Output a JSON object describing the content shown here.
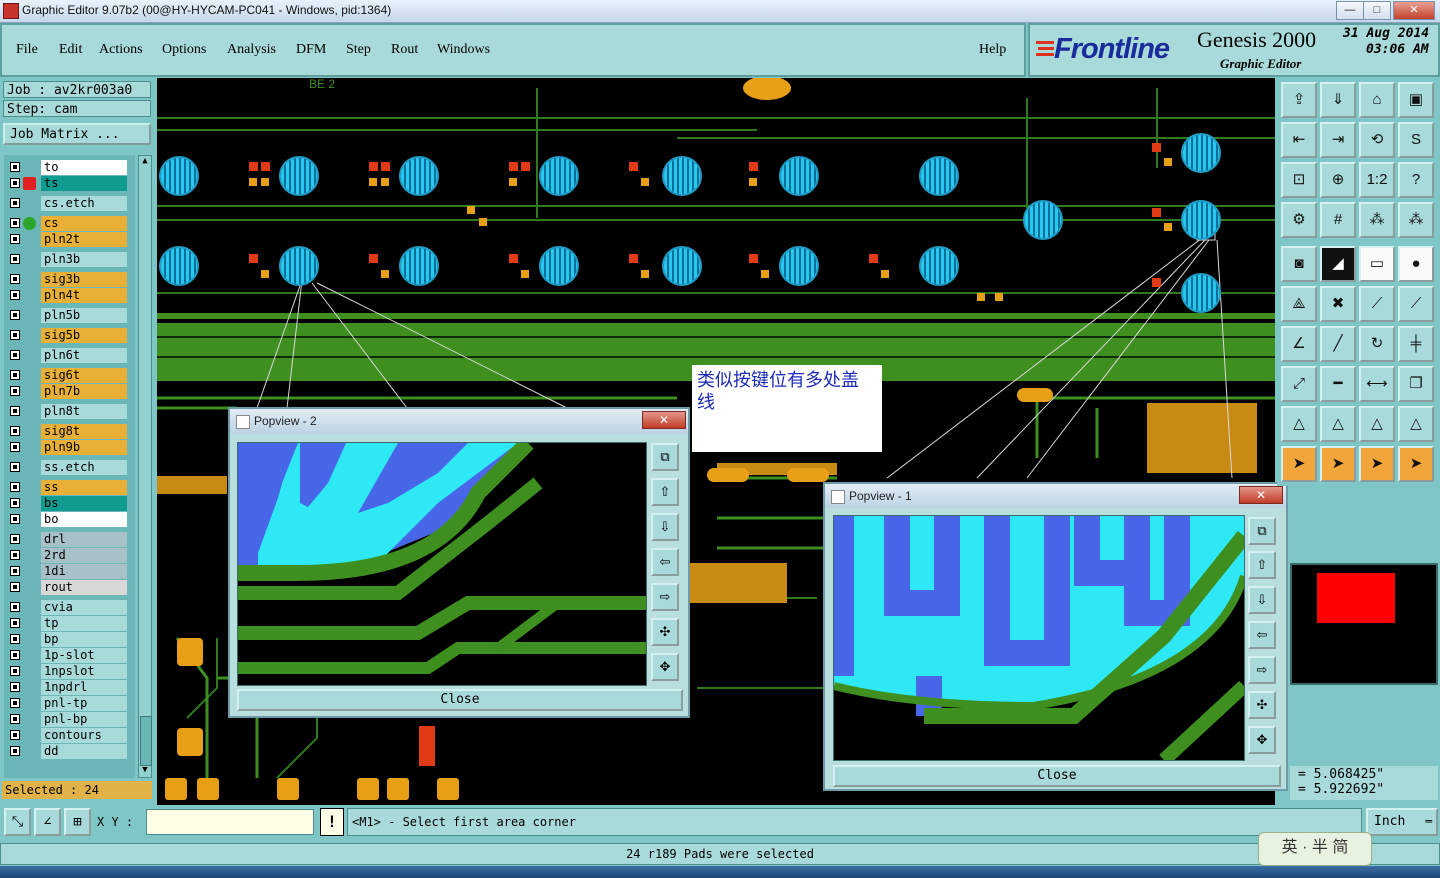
{
  "window": {
    "title": "Graphic Editor 9.07b2 (00@HY-HYCAM-PC041 - Windows, pid:1364)",
    "min": "—",
    "max": "□",
    "close": "✕"
  },
  "menu": {
    "items": [
      "File",
      "Edit",
      "Actions",
      "Options",
      "Analysis",
      "DFM",
      "Step",
      "Rout",
      "Windows"
    ],
    "help": "Help"
  },
  "brand": {
    "logo_text": "Frontline",
    "product": "Genesis 2000",
    "subtitle": "Graphic Editor",
    "date": "31 Aug 2014",
    "time": "03:06 AM"
  },
  "left": {
    "job": "Job : av2kr003a0",
    "step": "Step: cam",
    "job_matrix": "Job Matrix ...",
    "selected": "Selected : 24"
  },
  "layers": [
    {
      "name": "to",
      "color": "#ffffff"
    },
    {
      "name": "ts",
      "color": "#0f9b8e"
    },
    {
      "name": "cs.etch",
      "color": "#a9dada"
    },
    {
      "name": "cs",
      "color": "#e8b037"
    },
    {
      "name": "pln2t",
      "color": "#e8b037"
    },
    {
      "name": "pln3b",
      "color": "#a9dada"
    },
    {
      "name": "sig3b",
      "color": "#e8b037"
    },
    {
      "name": "pln4t",
      "color": "#e8b037"
    },
    {
      "name": "pln5b",
      "color": "#a9dada"
    },
    {
      "name": "sig5b",
      "color": "#e8b037"
    },
    {
      "name": "pln6t",
      "color": "#a9dada"
    },
    {
      "name": "sig6t",
      "color": "#e8b037"
    },
    {
      "name": "pln7b",
      "color": "#e8b037"
    },
    {
      "name": "pln8t",
      "color": "#a9dada"
    },
    {
      "name": "sig8t",
      "color": "#e8b037"
    },
    {
      "name": "pln9b",
      "color": "#e8b037"
    },
    {
      "name": "ss.etch",
      "color": "#a9dada"
    },
    {
      "name": "ss",
      "color": "#e8b037"
    },
    {
      "name": "bs",
      "color": "#0f9b8e"
    },
    {
      "name": "bo",
      "color": "#ffffff"
    },
    {
      "name": "drl",
      "color": "#a8c0c8"
    },
    {
      "name": "2rd",
      "color": "#a8c0c8"
    },
    {
      "name": "1di",
      "color": "#a8c0c8"
    },
    {
      "name": "rout",
      "color": "#d8d8d8"
    },
    {
      "name": "cvia",
      "color": "#a9dada"
    },
    {
      "name": "tp",
      "color": "#a9dada"
    },
    {
      "name": "bp",
      "color": "#a9dada"
    },
    {
      "name": "1p-slot",
      "color": "#a9dada"
    },
    {
      "name": "1npslot",
      "color": "#a9dada"
    },
    {
      "name": "1npdrl",
      "color": "#a9dada"
    },
    {
      "name": "pnl-tp",
      "color": "#a9dada"
    },
    {
      "name": "pnl-bp",
      "color": "#a9dada"
    },
    {
      "name": "contours",
      "color": "#a9dada"
    },
    {
      "name": "dd",
      "color": "#a9dada"
    }
  ],
  "canvas": {
    "annotation": "类似按键位有多处盖线",
    "board_label": "BE 2"
  },
  "popview2": {
    "title": "Popview - 2",
    "close": "Close"
  },
  "popview1": {
    "title": "Popview - 1",
    "close": "Close"
  },
  "coords": {
    "x": "= 5.068425\"",
    "y": "= 5.922692\""
  },
  "bottom": {
    "xy_label": "X Y :",
    "xy_value": "",
    "message": "<M1> - Select first area corner",
    "units": "Inch",
    "status": "24 r189 Pads were selected",
    "ime": "英 · 半 简"
  },
  "colors": {
    "board_green": "#3e8f1f",
    "pad_cyan": "#28c7f0",
    "trace_blue": "#4767e8",
    "panel_teal": "#7fc6c6",
    "highlight_red": "#ff0000"
  }
}
